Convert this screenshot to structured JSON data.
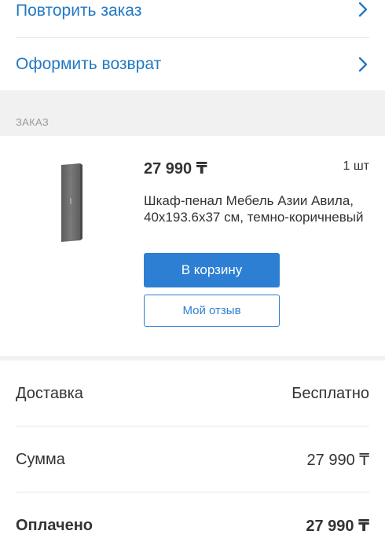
{
  "actions": {
    "repeat_order": "Повторить заказ",
    "make_return": "Оформить возврат"
  },
  "order_section": {
    "title": "ЗАКАЗ"
  },
  "item": {
    "price": "27 990 ₸",
    "quantity": "1 шт",
    "name": "Шкаф-пенал Мебель Азии Авила, 40x193.6x37 см, темно-коричневый",
    "add_to_cart_label": "В корзину",
    "review_label": "Мой отзыв"
  },
  "summary": {
    "delivery_label": "Доставка",
    "delivery_value": "Бесплатно",
    "sum_label": "Сумма",
    "sum_value": "27 990 ₸",
    "paid_label": "Оплачено",
    "paid_value": "27 990 ₸"
  },
  "colors": {
    "accent": "#2379c4",
    "button": "#2c7fd3",
    "section_bg": "#f1f1f1"
  },
  "icons": {
    "chevron": "chevron-right-icon",
    "product": "product-image"
  }
}
